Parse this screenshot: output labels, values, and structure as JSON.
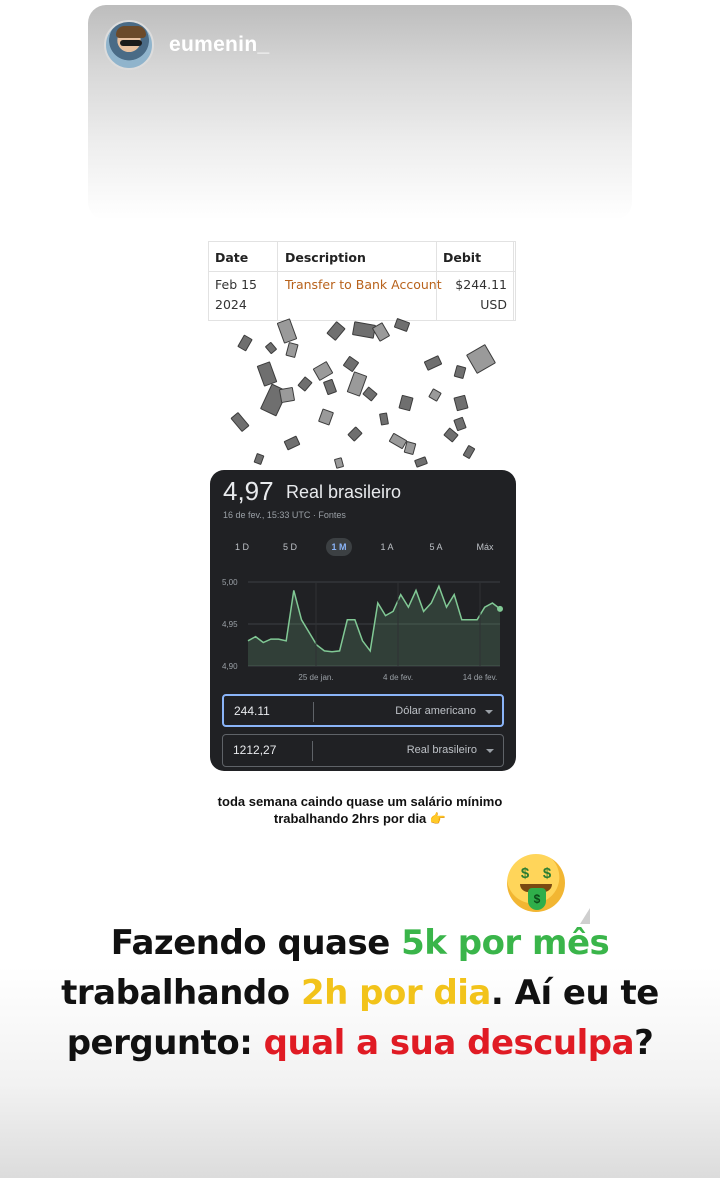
{
  "story": {
    "username": "eumenin_"
  },
  "transaction": {
    "headers": [
      "Date",
      "Description",
      "Debit"
    ],
    "date_line1": "Feb 15",
    "date_line2": "2024",
    "description": "Transfer to Bank Account",
    "debit_line1": "$244.11",
    "debit_line2": "USD"
  },
  "currency_card": {
    "rate": "4,97",
    "currency_name": "Real brasileiro",
    "timestamp": "16 de fev., 15:33 UTC · Fontes",
    "tabs": [
      "1 D",
      "5 D",
      "1 M",
      "1 A",
      "5 A",
      "Máx"
    ],
    "active_tab": "1 M",
    "converter": {
      "from_value": "244.11",
      "from_currency": "Dólar americano",
      "to_value": "1212,27",
      "to_currency": "Real brasileiro"
    }
  },
  "chart_data": {
    "type": "area",
    "y_ticks": [
      "5,00",
      "4,95",
      "4,90"
    ],
    "x_ticks": [
      "25 de jan.",
      "4 de fev.",
      "14 de fev."
    ],
    "ylim": [
      4.9,
      5.0
    ],
    "values": [
      4.93,
      4.935,
      4.928,
      4.932,
      4.932,
      4.93,
      4.99,
      4.955,
      4.94,
      4.925,
      4.918,
      4.917,
      4.918,
      4.955,
      4.955,
      4.93,
      4.918,
      4.975,
      4.96,
      4.965,
      4.985,
      4.97,
      4.99,
      4.965,
      4.975,
      4.995,
      4.97,
      4.985,
      4.955,
      4.955,
      4.955,
      4.97,
      4.975,
      4.968
    ],
    "line_color": "#81c995"
  },
  "caption": {
    "line1": "toda semana caindo quase um salário mínimo",
    "line2": "trabalhando 2hrs por dia",
    "emoji": "👉"
  },
  "headline": {
    "p1": "Fazendo quase ",
    "p2": "5k por mês",
    "p3": "trabalhando ",
    "p4": "2h por dia",
    "p5": ". Aí eu te",
    "p6": "pergunto: ",
    "p7": "qual a sua desculpa",
    "p8": "?"
  },
  "colors": {
    "green": "#3ab54a",
    "yellow": "#f2c31a",
    "red": "#e01b24",
    "link": "#b8621b"
  },
  "icons": [
    "money-mouth-face-icon",
    "pointing-hand-icon",
    "dropdown-caret-icon"
  ]
}
